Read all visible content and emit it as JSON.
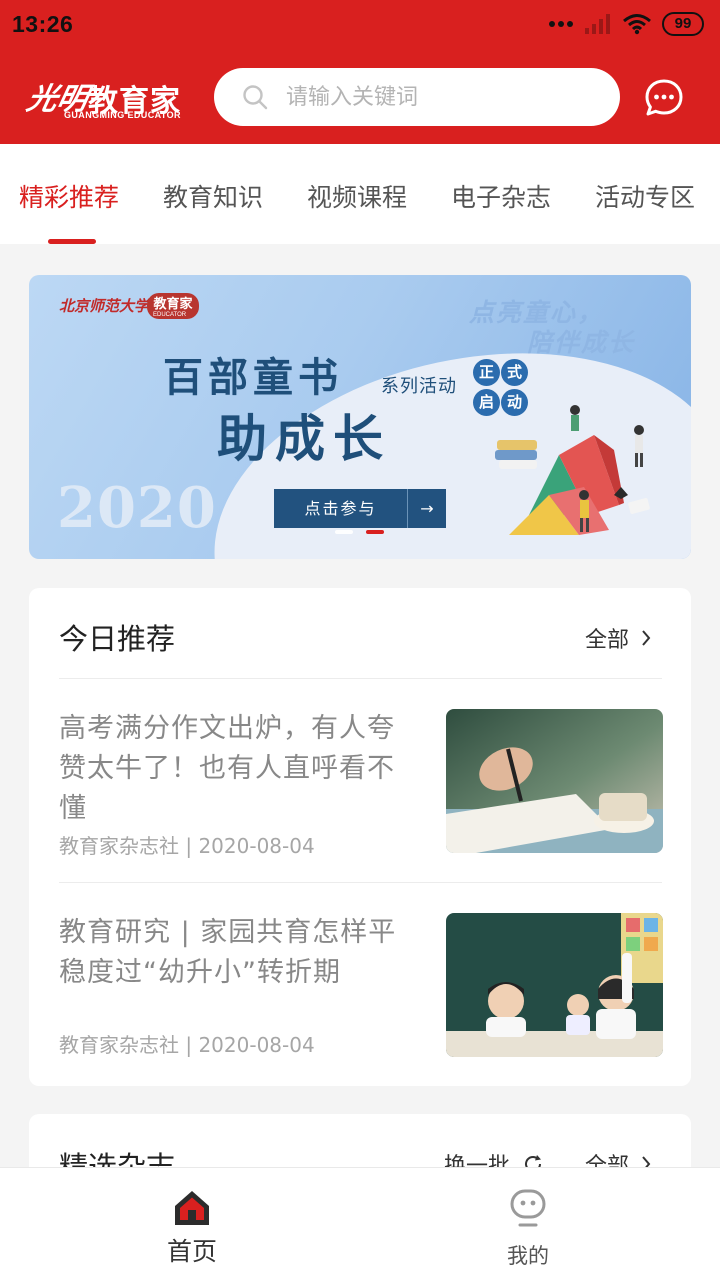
{
  "status_bar": {
    "time": "13:26",
    "battery": "99"
  },
  "header": {
    "logo_script": "光明",
    "logo_text": "教育家",
    "logo_sub": "GUANGMING EDUCATOR",
    "search_placeholder": "请输入关键词",
    "message_icon": "chat-bubble-icon"
  },
  "tabs": [
    {
      "label": "精彩推荐",
      "active": true
    },
    {
      "label": "教育知识"
    },
    {
      "label": "视频课程"
    },
    {
      "label": "电子杂志"
    },
    {
      "label": "活动专区"
    }
  ],
  "banner": {
    "school": "北京师范大学",
    "brand": "教育家",
    "brand_sub": "EDUCATOR",
    "slogan_line1": "点亮童心，",
    "slogan_line2": "陪伴成长",
    "title_line1": "百部童书",
    "title_line2": "助成长",
    "series": "系列活动",
    "badges": [
      "正",
      "式",
      "启",
      "动"
    ],
    "year": "2020",
    "cta": "点击参与",
    "cta_arrow": "→",
    "slide_count": 2,
    "active_slide": 2,
    "accent_color": "#d9201f"
  },
  "today": {
    "title": "今日推荐",
    "more": "全部",
    "articles": [
      {
        "title": "高考满分作文出炉，有人夸赞太牛了！也有人直呼看不懂",
        "meta": "教育家杂志社 | 2020-08-04",
        "image": "writing-notebook-photo"
      },
      {
        "title": "教育研究 | 家园共育怎样平稳度过“幼升小”转折期",
        "meta": "教育家杂志社 | 2020-08-04",
        "image": "classroom-children-photo"
      }
    ]
  },
  "magazines": {
    "title": "精选杂志",
    "swap": "换一批",
    "more": "全部"
  },
  "bottom_nav": [
    {
      "label": "首页",
      "icon": "home-icon",
      "active": true
    },
    {
      "label": "我的",
      "icon": "profile-icon",
      "active": false
    }
  ],
  "colors": {
    "brand_red": "#d9201f",
    "text_gray": "#888888"
  }
}
